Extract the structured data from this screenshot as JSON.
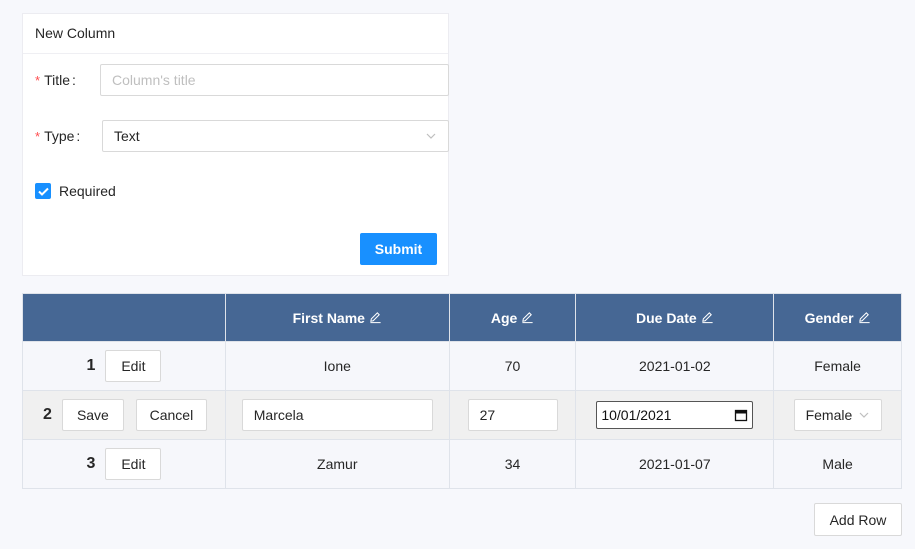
{
  "form": {
    "title": "New Column",
    "title_label": "Title",
    "title_placeholder": "Column's title",
    "type_label": "Type",
    "type_value": "Text",
    "required_label": "Required",
    "required_checked": true,
    "submit_label": "Submit",
    "colon": ":",
    "asterisk": "*"
  },
  "table": {
    "headers": [
      "",
      "First Name",
      "Age",
      "Due Date",
      "Gender"
    ],
    "rows": [
      {
        "index": "1",
        "edit_label": "Edit",
        "first_name": "Ione",
        "age": "70",
        "due_date": "2021-01-02",
        "gender": "Female"
      },
      {
        "index": "2",
        "save_label": "Save",
        "cancel_label": "Cancel",
        "first_name": "Marcela",
        "age": "27",
        "due_date": "10/01/2021",
        "gender": "Female"
      },
      {
        "index": "3",
        "edit_label": "Edit",
        "first_name": "Zamur",
        "age": "34",
        "due_date": "2021-01-07",
        "gender": "Male"
      }
    ]
  },
  "add_row_label": "Add Row",
  "colors": {
    "primary": "#1890ff",
    "header_bg": "#466794",
    "required": "#ff4d4f"
  }
}
